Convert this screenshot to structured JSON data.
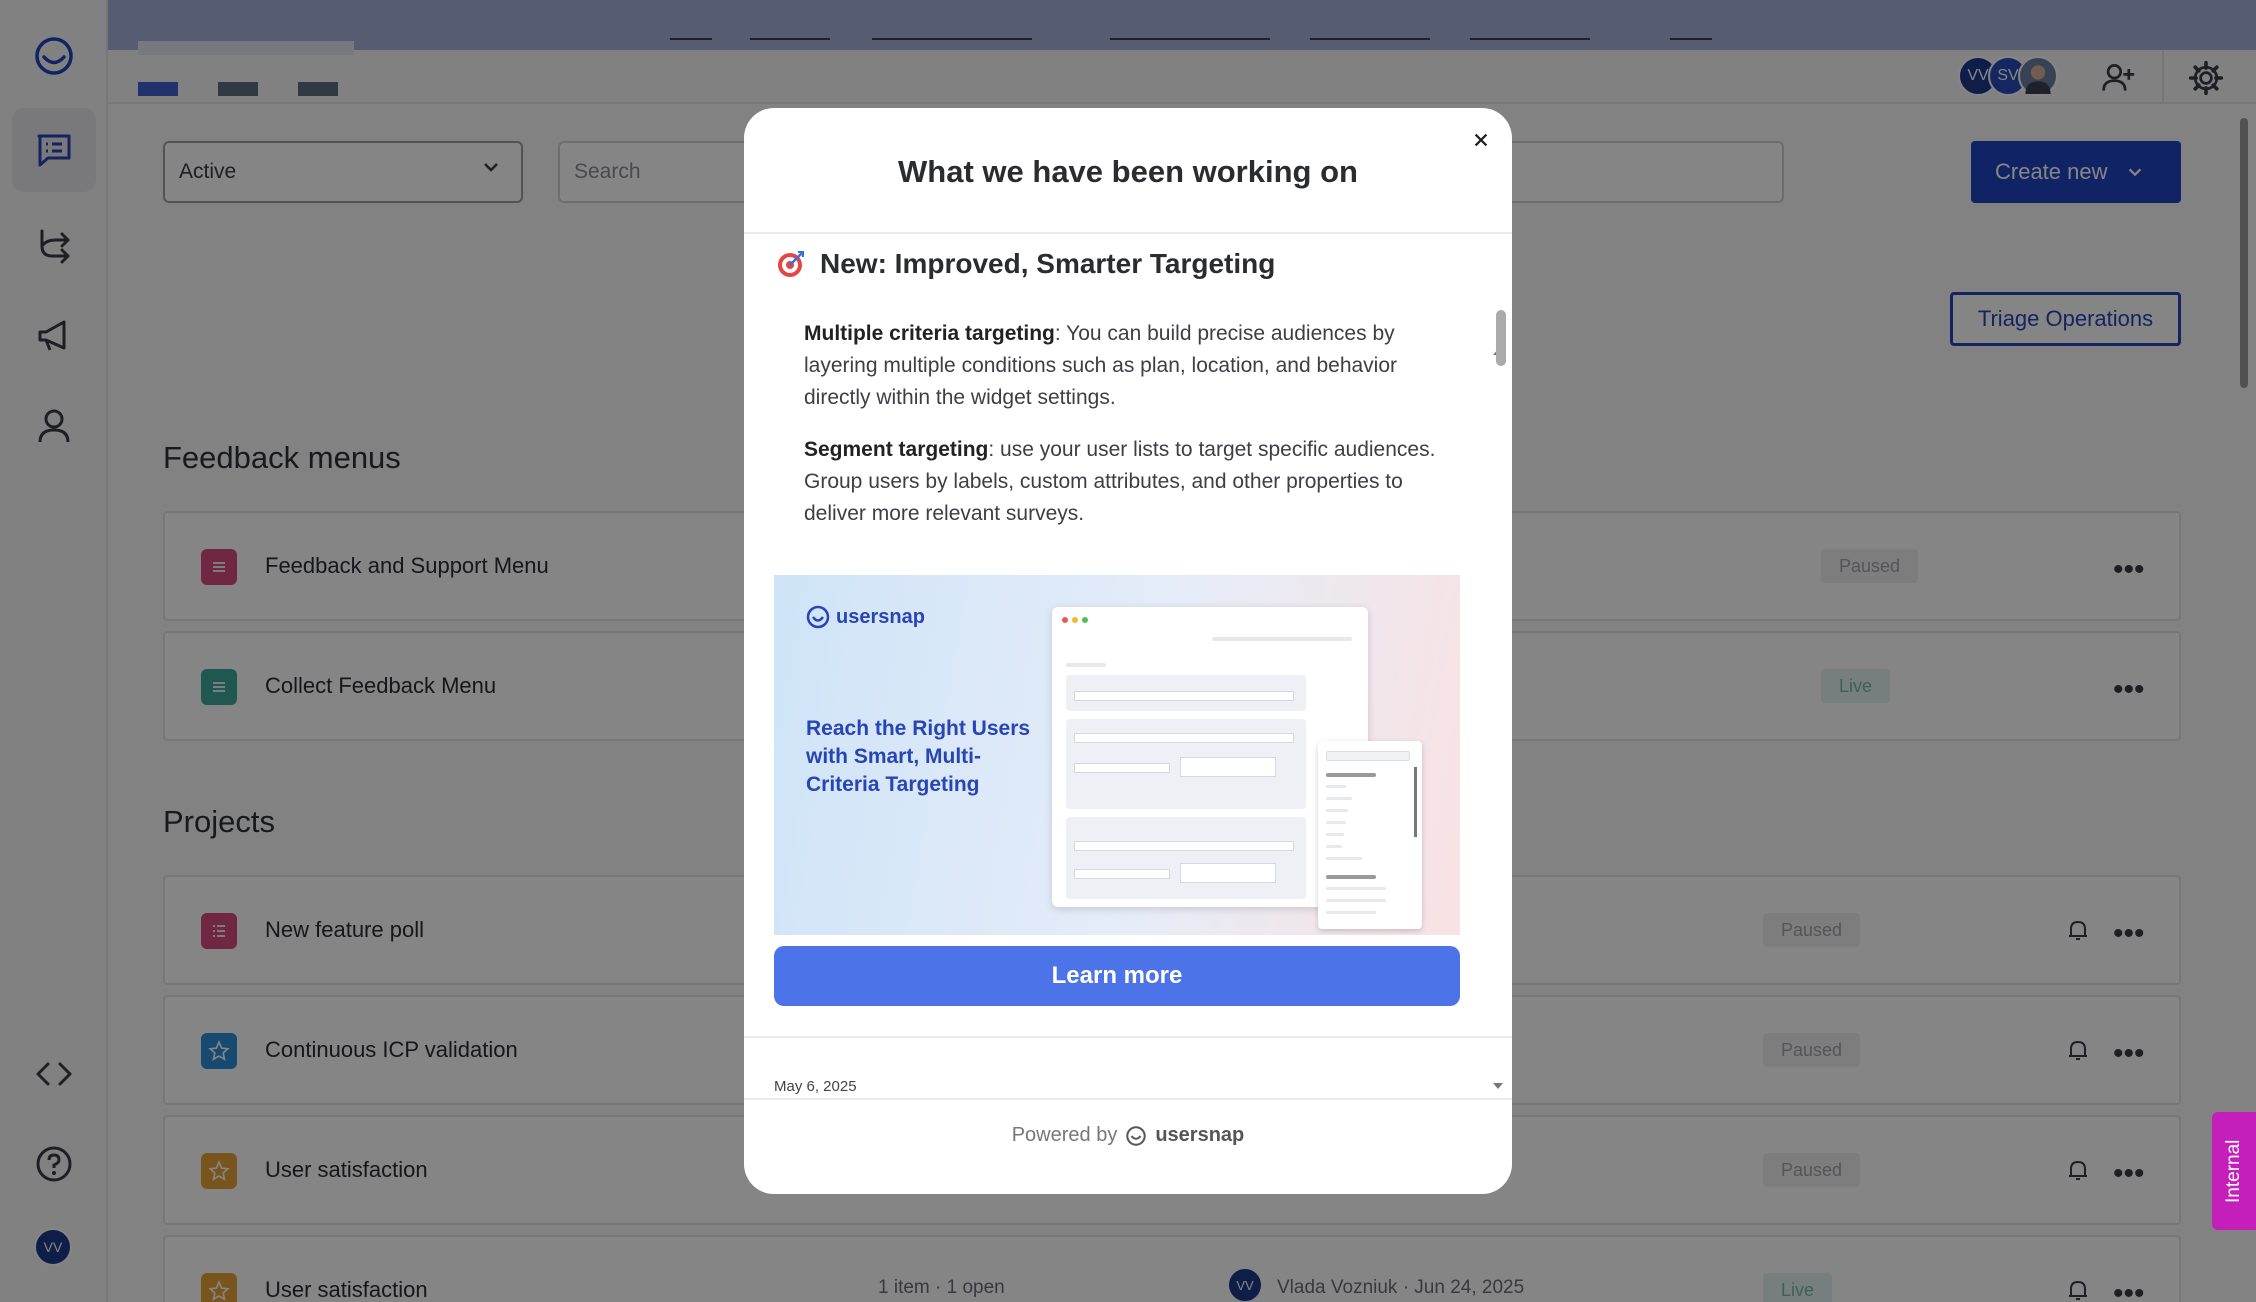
{
  "toolbar": {
    "status_filter": "Active",
    "search_placeholder": "Search",
    "create_label": "Create new",
    "triage_label": "Triage Operations"
  },
  "header": {
    "avatars": [
      {
        "initials": "VV",
        "color": "#1e3a8a"
      },
      {
        "initials": "SV",
        "color": "#2a4ab8"
      }
    ]
  },
  "sidebar": {
    "user_initials": "VV"
  },
  "feedback_menus": {
    "title": "Feedback menus",
    "items": [
      {
        "name": "Feedback and Support Menu",
        "status": "Paused",
        "color": "#d64b7d"
      },
      {
        "name": "Collect Feedback Menu",
        "status": "Live",
        "color": "#3fa79a"
      }
    ]
  },
  "projects": {
    "title": "Projects",
    "items": [
      {
        "name": "New feature poll",
        "status": "Paused",
        "color": "#d64b7d",
        "icon": "list-icon"
      },
      {
        "name": "Continuous ICP validation",
        "status": "Paused",
        "color": "#2b8fd6",
        "icon": "star-icon"
      },
      {
        "name": "User satisfaction",
        "status": "Paused",
        "color": "#e8a43a",
        "icon": "star-icon"
      },
      {
        "name": "User satisfaction",
        "status": "Live",
        "color": "#e8a43a",
        "icon": "star-icon",
        "items_text": "1 item · 1 open",
        "owner_initials": "VV",
        "owner_text": "Vlada Vozniuk · Jun 24, 2025"
      }
    ]
  },
  "modal": {
    "title": "What we have been working on",
    "post_title": "New: Improved, Smarter Targeting",
    "para1_bold": "Multiple criteria targeting",
    "para1_text": ": You can build precise audiences by layering multiple conditions such as plan, location, and behavior directly within the widget settings.",
    "para2_bold": "Segment targeting",
    "para2_text": ": use your user lists to target specific audiences. Group users by labels, custom attributes, and other properties to deliver more relevant surveys.",
    "promo_brand": "usersnap",
    "promo_headline": "Reach the Right Users with Smart, Multi-Criteria Targeting",
    "learn_more": "Learn more",
    "next_date": "May 6, 2025",
    "powered_by": "Powered by",
    "powered_brand": "usersnap"
  },
  "internal_tab": "Internal"
}
